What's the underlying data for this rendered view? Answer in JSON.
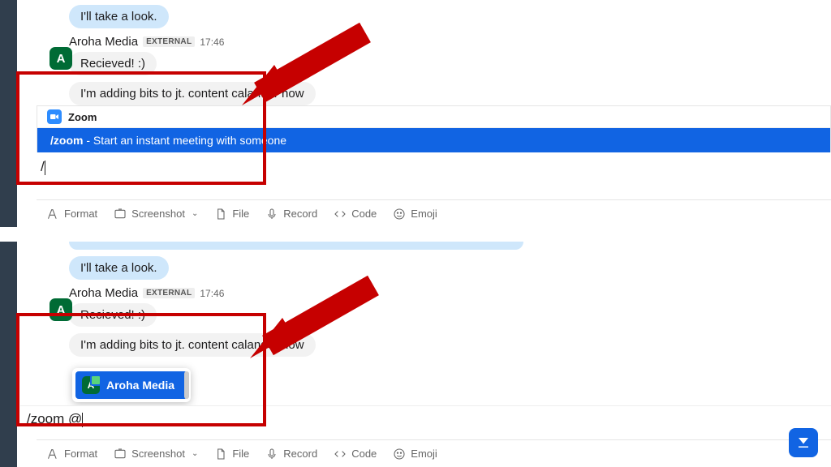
{
  "top": {
    "prev_bubble": "I'll take a look.",
    "sender": "Aroha Media",
    "external": "EXTERNAL",
    "time": "17:46",
    "avatar": "A",
    "msg1": "Recieved! :)",
    "msg2": "I'm adding bits to jt. content calander now",
    "cmd_app": "Zoom",
    "cmd_name": "/zoom",
    "cmd_desc": " - Start an instant meeting with someone",
    "input": "/"
  },
  "bottom": {
    "prev_bubble": "I'll take a look.",
    "sender": "Aroha Media",
    "external": "EXTERNAL",
    "time": "17:46",
    "avatar": "A",
    "msg1": "Recieved! :)",
    "msg2": "I'm adding bits to jt. content calander now",
    "mention": "Aroha Media",
    "mention_avatar": "A",
    "input": "/zoom @"
  },
  "toolbar": {
    "format": "Format",
    "screenshot": "Screenshot",
    "file": "File",
    "record": "Record",
    "code": "Code",
    "emoji": "Emoji"
  }
}
